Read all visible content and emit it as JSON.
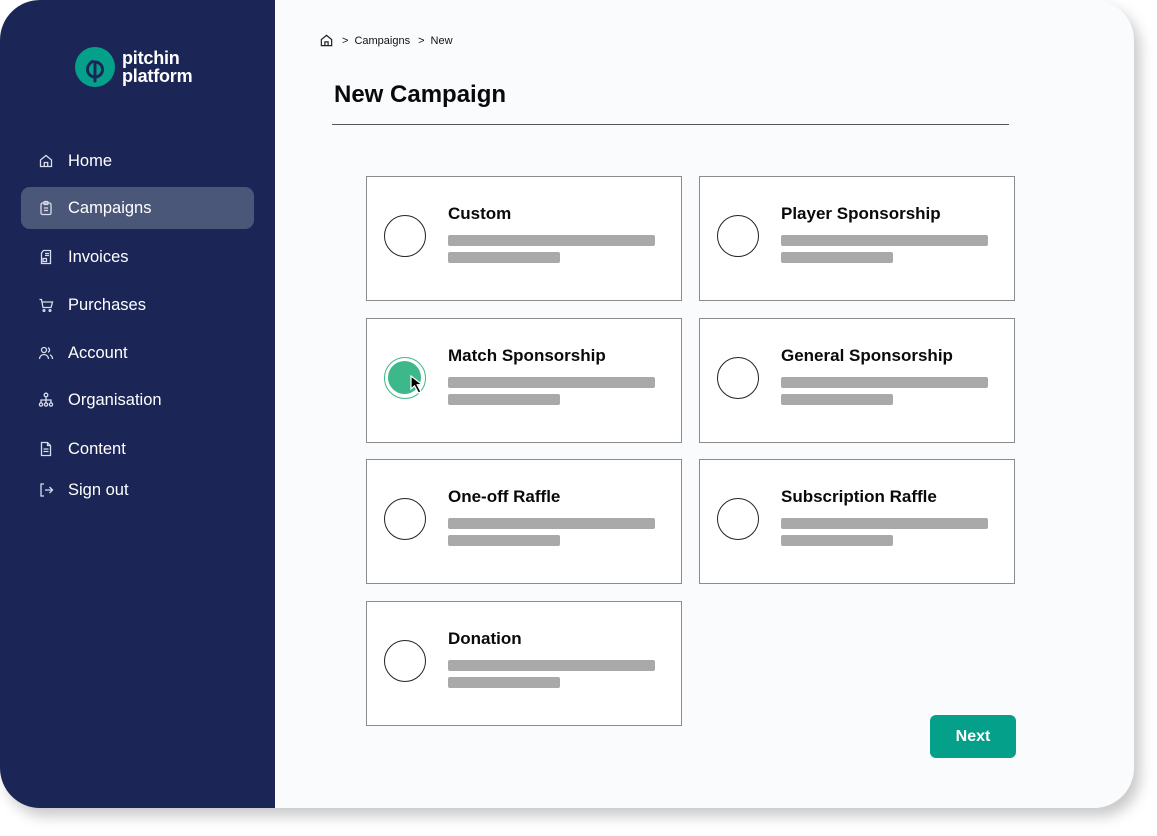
{
  "brand": {
    "name_line1": "pitchin",
    "name_line2": "platform",
    "accent_color": "#04a08a",
    "sidebar_color": "#1b2656"
  },
  "sidebar": {
    "items": [
      {
        "label": "Home",
        "icon": "home-icon",
        "active": false
      },
      {
        "label": "Campaigns",
        "icon": "clipboard-icon",
        "active": true
      },
      {
        "label": "Invoices",
        "icon": "invoice-icon",
        "active": false
      },
      {
        "label": "Purchases",
        "icon": "cart-icon",
        "active": false
      },
      {
        "label": "Account",
        "icon": "users-icon",
        "active": false
      },
      {
        "label": "Organisation",
        "icon": "org-chart-icon",
        "active": false
      },
      {
        "label": "Content",
        "icon": "document-icon",
        "active": false
      },
      {
        "label": "Sign out",
        "icon": "sign-out-icon",
        "active": false
      }
    ]
  },
  "breadcrumb": {
    "items": [
      "Campaigns",
      "New"
    ]
  },
  "page": {
    "title": "New Campaign"
  },
  "campaign_types": [
    {
      "label": "Custom",
      "selected": false
    },
    {
      "label": "Player Sponsorship",
      "selected": false
    },
    {
      "label": "Match Sponsorship",
      "selected": true
    },
    {
      "label": "General Sponsorship",
      "selected": false
    },
    {
      "label": "One-off Raffle",
      "selected": false
    },
    {
      "label": "Subscription Raffle",
      "selected": false
    },
    {
      "label": "Donation",
      "selected": false
    }
  ],
  "actions": {
    "next_label": "Next"
  }
}
